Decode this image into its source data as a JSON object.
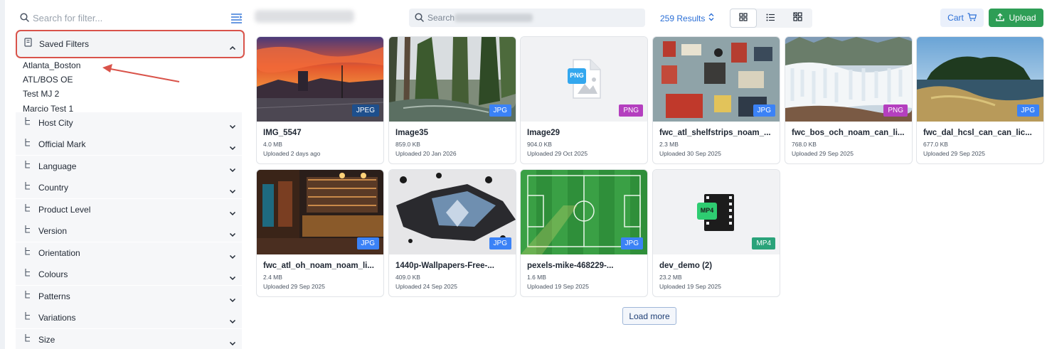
{
  "sidebar": {
    "search_placeholder": "Search for filter...",
    "saved_filters": {
      "label": "Saved Filters",
      "items": [
        "Atlanta_Boston",
        "ATL/BOS OE",
        "Test MJ 2",
        "Marcio Test 1"
      ]
    },
    "groups": [
      "Host City",
      "Official Mark",
      "Language",
      "Country",
      "Product Level",
      "Version",
      "Orientation",
      "Colours",
      "Patterns",
      "Variations",
      "Size"
    ]
  },
  "topbar": {
    "search_placeholder": "Search",
    "results": "259 Results",
    "cart_label": "Cart",
    "upload_label": "Upload"
  },
  "assets": [
    {
      "name": "IMG_5547",
      "size": "4.0 MB",
      "uploaded": "Uploaded 2 days ago",
      "type": "JPEG"
    },
    {
      "name": "Image35",
      "size": "859.0 KB",
      "uploaded": "Uploaded 20 Jan 2026",
      "type": "JPG"
    },
    {
      "name": "Image29",
      "size": "904.0 KB",
      "uploaded": "Uploaded 29 Oct 2025",
      "type": "PNG",
      "icon_text": "PNG"
    },
    {
      "name": "fwc_atl_shelfstrips_noam_...",
      "size": "2.3 MB",
      "uploaded": "Uploaded 30 Sep 2025",
      "type": "JPG"
    },
    {
      "name": "fwc_bos_och_noam_can_li...",
      "size": "768.0 KB",
      "uploaded": "Uploaded 29 Sep 2025",
      "type": "PNG"
    },
    {
      "name": "fwc_dal_hcsl_can_can_lic...",
      "size": "677.0 KB",
      "uploaded": "Uploaded 29 Sep 2025",
      "type": "JPG"
    },
    {
      "name": "fwc_atl_oh_noam_noam_li...",
      "size": "2.4 MB",
      "uploaded": "Uploaded 29 Sep 2025",
      "type": "JPG"
    },
    {
      "name": "1440p-Wallpapers-Free-...",
      "size": "409.0 KB",
      "uploaded": "Uploaded 24 Sep 2025",
      "type": "JPG"
    },
    {
      "name": "pexels-mike-468229-...",
      "size": "1.6 MB",
      "uploaded": "Uploaded 19 Sep 2025",
      "type": "JPG"
    },
    {
      "name": "dev_demo (2)",
      "size": "23.2 MB",
      "uploaded": "Uploaded 19 Sep 2025",
      "type": "MP4",
      "icon_text": "MP4"
    }
  ],
  "load_more_label": "Load more",
  "colors": {
    "accent_blue": "#2b6fd6",
    "jpg_badge": "#3b82f6",
    "jpeg_badge": "#1e4f8c",
    "png_badge": "#b43fbf",
    "mp4_badge": "#2aa37a",
    "upload_green": "#2e9e56",
    "highlight_red": "#d9534a"
  }
}
